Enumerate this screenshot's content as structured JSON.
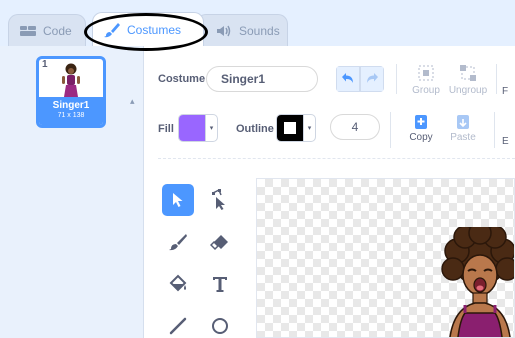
{
  "tabs": {
    "code": "Code",
    "costumes": "Costumes",
    "sounds": "Sounds"
  },
  "costume_list": {
    "items": [
      {
        "number": "1",
        "name": "Singer1",
        "size": "71 x 138",
        "selected": true
      }
    ]
  },
  "toolbar": {
    "costume_label": "Costume",
    "costume_name": "Singer1",
    "group_label": "Group",
    "ungroup_label": "Ungroup",
    "edge_letter_1": "F",
    "fill_label": "Fill",
    "fill_color": "#9966ff",
    "outline_label": "Outline",
    "outline_color": "#000000",
    "outline_width": "4",
    "copy_label": "Copy",
    "paste_label": "Paste",
    "edge_letter_2": "E"
  },
  "palette": {
    "tools": [
      "select-icon",
      "reshape-icon",
      "brush-icon",
      "eraser-icon",
      "fill-icon",
      "text-icon",
      "line-icon",
      "circle-icon"
    ],
    "active_tool": "select-icon"
  },
  "colors": {
    "accent": "#4c97ff",
    "tab_inactive_text": "#8a9bb5",
    "label_text": "#575e75"
  }
}
